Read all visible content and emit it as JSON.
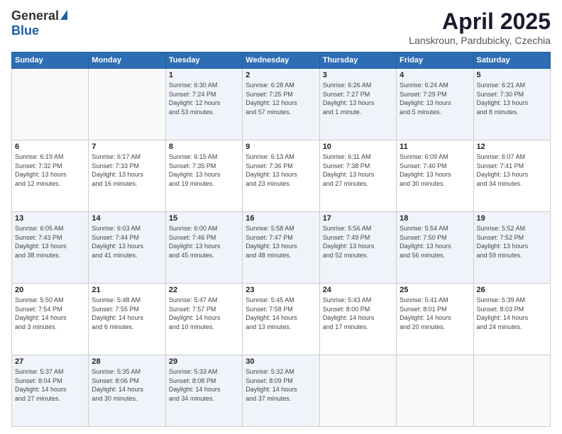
{
  "logo": {
    "general": "General",
    "blue": "Blue"
  },
  "title": {
    "month": "April 2025",
    "location": "Lanskroun, Pardubicky, Czechia"
  },
  "weekdays": [
    "Sunday",
    "Monday",
    "Tuesday",
    "Wednesday",
    "Thursday",
    "Friday",
    "Saturday"
  ],
  "weeks": [
    [
      {
        "day": "",
        "info": ""
      },
      {
        "day": "",
        "info": ""
      },
      {
        "day": "1",
        "info": "Sunrise: 6:30 AM\nSunset: 7:24 PM\nDaylight: 12 hours\nand 53 minutes."
      },
      {
        "day": "2",
        "info": "Sunrise: 6:28 AM\nSunset: 7:25 PM\nDaylight: 12 hours\nand 57 minutes."
      },
      {
        "day": "3",
        "info": "Sunrise: 6:26 AM\nSunset: 7:27 PM\nDaylight: 13 hours\nand 1 minute."
      },
      {
        "day": "4",
        "info": "Sunrise: 6:24 AM\nSunset: 7:29 PM\nDaylight: 13 hours\nand 5 minutes."
      },
      {
        "day": "5",
        "info": "Sunrise: 6:21 AM\nSunset: 7:30 PM\nDaylight: 13 hours\nand 8 minutes."
      }
    ],
    [
      {
        "day": "6",
        "info": "Sunrise: 6:19 AM\nSunset: 7:32 PM\nDaylight: 13 hours\nand 12 minutes."
      },
      {
        "day": "7",
        "info": "Sunrise: 6:17 AM\nSunset: 7:33 PM\nDaylight: 13 hours\nand 16 minutes."
      },
      {
        "day": "8",
        "info": "Sunrise: 6:15 AM\nSunset: 7:35 PM\nDaylight: 13 hours\nand 19 minutes."
      },
      {
        "day": "9",
        "info": "Sunrise: 6:13 AM\nSunset: 7:36 PM\nDaylight: 13 hours\nand 23 minutes."
      },
      {
        "day": "10",
        "info": "Sunrise: 6:11 AM\nSunset: 7:38 PM\nDaylight: 13 hours\nand 27 minutes."
      },
      {
        "day": "11",
        "info": "Sunrise: 6:09 AM\nSunset: 7:40 PM\nDaylight: 13 hours\nand 30 minutes."
      },
      {
        "day": "12",
        "info": "Sunrise: 6:07 AM\nSunset: 7:41 PM\nDaylight: 13 hours\nand 34 minutes."
      }
    ],
    [
      {
        "day": "13",
        "info": "Sunrise: 6:05 AM\nSunset: 7:43 PM\nDaylight: 13 hours\nand 38 minutes."
      },
      {
        "day": "14",
        "info": "Sunrise: 6:03 AM\nSunset: 7:44 PM\nDaylight: 13 hours\nand 41 minutes."
      },
      {
        "day": "15",
        "info": "Sunrise: 6:00 AM\nSunset: 7:46 PM\nDaylight: 13 hours\nand 45 minutes."
      },
      {
        "day": "16",
        "info": "Sunrise: 5:58 AM\nSunset: 7:47 PM\nDaylight: 13 hours\nand 48 minutes."
      },
      {
        "day": "17",
        "info": "Sunrise: 5:56 AM\nSunset: 7:49 PM\nDaylight: 13 hours\nand 52 minutes."
      },
      {
        "day": "18",
        "info": "Sunrise: 5:54 AM\nSunset: 7:50 PM\nDaylight: 13 hours\nand 56 minutes."
      },
      {
        "day": "19",
        "info": "Sunrise: 5:52 AM\nSunset: 7:52 PM\nDaylight: 13 hours\nand 59 minutes."
      }
    ],
    [
      {
        "day": "20",
        "info": "Sunrise: 5:50 AM\nSunset: 7:54 PM\nDaylight: 14 hours\nand 3 minutes."
      },
      {
        "day": "21",
        "info": "Sunrise: 5:48 AM\nSunset: 7:55 PM\nDaylight: 14 hours\nand 6 minutes."
      },
      {
        "day": "22",
        "info": "Sunrise: 5:47 AM\nSunset: 7:57 PM\nDaylight: 14 hours\nand 10 minutes."
      },
      {
        "day": "23",
        "info": "Sunrise: 5:45 AM\nSunset: 7:58 PM\nDaylight: 14 hours\nand 13 minutes."
      },
      {
        "day": "24",
        "info": "Sunrise: 5:43 AM\nSunset: 8:00 PM\nDaylight: 14 hours\nand 17 minutes."
      },
      {
        "day": "25",
        "info": "Sunrise: 5:41 AM\nSunset: 8:01 PM\nDaylight: 14 hours\nand 20 minutes."
      },
      {
        "day": "26",
        "info": "Sunrise: 5:39 AM\nSunset: 8:03 PM\nDaylight: 14 hours\nand 24 minutes."
      }
    ],
    [
      {
        "day": "27",
        "info": "Sunrise: 5:37 AM\nSunset: 8:04 PM\nDaylight: 14 hours\nand 27 minutes."
      },
      {
        "day": "28",
        "info": "Sunrise: 5:35 AM\nSunset: 8:06 PM\nDaylight: 14 hours\nand 30 minutes."
      },
      {
        "day": "29",
        "info": "Sunrise: 5:33 AM\nSunset: 8:08 PM\nDaylight: 14 hours\nand 34 minutes."
      },
      {
        "day": "30",
        "info": "Sunrise: 5:32 AM\nSunset: 8:09 PM\nDaylight: 14 hours\nand 37 minutes."
      },
      {
        "day": "",
        "info": ""
      },
      {
        "day": "",
        "info": ""
      },
      {
        "day": "",
        "info": ""
      }
    ]
  ]
}
